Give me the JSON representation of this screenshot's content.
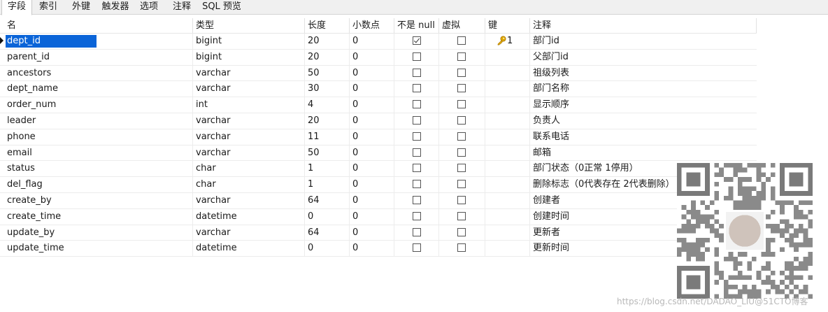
{
  "tabs": [
    {
      "label": "字段",
      "active": true
    },
    {
      "label": "索引",
      "active": false
    },
    {
      "label": "外键",
      "active": false
    },
    {
      "label": "触发器",
      "active": false
    },
    {
      "label": "选项",
      "active": false
    },
    {
      "label": "注释",
      "active": false
    },
    {
      "label": "SQL 预览",
      "active": false
    }
  ],
  "columns": {
    "name": "名",
    "type": "类型",
    "length": "长度",
    "decimals": "小数点",
    "not_null": "不是 null",
    "virtual": "虚拟",
    "key": "键",
    "comment": "注释"
  },
  "rows": [
    {
      "name": "dept_id",
      "type": "bigint",
      "length": "20",
      "decimals": "0",
      "not_null": true,
      "virtual": false,
      "key": "1",
      "comment": "部门id"
    },
    {
      "name": "parent_id",
      "type": "bigint",
      "length": "20",
      "decimals": "0",
      "not_null": false,
      "virtual": false,
      "key": "",
      "comment": "父部门id"
    },
    {
      "name": "ancestors",
      "type": "varchar",
      "length": "50",
      "decimals": "0",
      "not_null": false,
      "virtual": false,
      "key": "",
      "comment": "祖级列表"
    },
    {
      "name": "dept_name",
      "type": "varchar",
      "length": "30",
      "decimals": "0",
      "not_null": false,
      "virtual": false,
      "key": "",
      "comment": "部门名称"
    },
    {
      "name": "order_num",
      "type": "int",
      "length": "4",
      "decimals": "0",
      "not_null": false,
      "virtual": false,
      "key": "",
      "comment": "显示顺序"
    },
    {
      "name": "leader",
      "type": "varchar",
      "length": "20",
      "decimals": "0",
      "not_null": false,
      "virtual": false,
      "key": "",
      "comment": "负责人"
    },
    {
      "name": "phone",
      "type": "varchar",
      "length": "11",
      "decimals": "0",
      "not_null": false,
      "virtual": false,
      "key": "",
      "comment": "联系电话"
    },
    {
      "name": "email",
      "type": "varchar",
      "length": "50",
      "decimals": "0",
      "not_null": false,
      "virtual": false,
      "key": "",
      "comment": "邮箱"
    },
    {
      "name": "status",
      "type": "char",
      "length": "1",
      "decimals": "0",
      "not_null": false,
      "virtual": false,
      "key": "",
      "comment": "部门状态（0正常 1停用）"
    },
    {
      "name": "del_flag",
      "type": "char",
      "length": "1",
      "decimals": "0",
      "not_null": false,
      "virtual": false,
      "key": "",
      "comment": "删除标志（0代表存在 2代表删除）"
    },
    {
      "name": "create_by",
      "type": "varchar",
      "length": "64",
      "decimals": "0",
      "not_null": false,
      "virtual": false,
      "key": "",
      "comment": "创建者"
    },
    {
      "name": "create_time",
      "type": "datetime",
      "length": "0",
      "decimals": "0",
      "not_null": false,
      "virtual": false,
      "key": "",
      "comment": "创建时间"
    },
    {
      "name": "update_by",
      "type": "varchar",
      "length": "64",
      "decimals": "0",
      "not_null": false,
      "virtual": false,
      "key": "",
      "comment": "更新者"
    },
    {
      "name": "update_time",
      "type": "datetime",
      "length": "0",
      "decimals": "0",
      "not_null": false,
      "virtual": false,
      "key": "",
      "comment": "更新时间"
    }
  ],
  "selected_row": 0,
  "key_icon": "key-icon",
  "colors": {
    "selection": "#0a64d8",
    "key": "#d9a000"
  },
  "watermark": "https://blog.csdn.net/DADAO_LIU@51CTO博客"
}
